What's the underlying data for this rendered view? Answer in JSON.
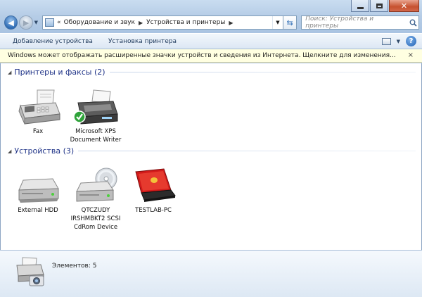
{
  "address": {
    "chevron": "«",
    "crumbs": [
      "Оборудование и звук",
      "Устройства и принтеры"
    ]
  },
  "search": {
    "placeholder": "Поиск: Устройства и принтеры"
  },
  "toolbar": {
    "add_device": "Добавление устройства",
    "install_printer": "Установка принтера"
  },
  "infobar": {
    "text": "Windows может отображать расширенные значки устройств и сведения из Интернета.  Щелкните для изменения...",
    "close": "×"
  },
  "groups": [
    {
      "title": "Принтеры и факсы (2)",
      "devices": [
        {
          "label": "Fax",
          "icon": "fax-icon"
        },
        {
          "label": "Microsoft XPS Document Writer",
          "icon": "printer-default-icon"
        }
      ]
    },
    {
      "title": "Устройства (3)",
      "devices": [
        {
          "label": "External HDD",
          "icon": "hard-drive-icon"
        },
        {
          "label": "QTCZUDY IRSHMBKT2 SCSI CdRom Device",
          "icon": "cdrom-drive-icon"
        },
        {
          "label": "TESTLAB-PC",
          "icon": "laptop-icon"
        }
      ]
    }
  ],
  "status": {
    "count": "Элементов: 5",
    "icon": "printer-camera-icon"
  },
  "colors": {
    "group_title": "#1e3287",
    "infobar_bg": "#ffffe1",
    "laptop": "#d21a1a"
  }
}
